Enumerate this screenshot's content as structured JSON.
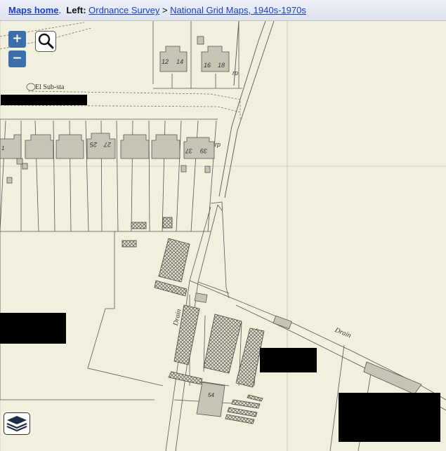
{
  "breadcrumb": {
    "home": "Maps home",
    "left_label": "Left:",
    "level1": "Ordnance Survey",
    "separator": ">",
    "level2": "National Grid Maps, 1940s-1970s"
  },
  "controls": {
    "zoom_in": "+",
    "zoom_out": "−"
  },
  "map_labels": {
    "substation": "El Sub-sta",
    "house_12": "12",
    "house_14": "14",
    "house_16": "16",
    "house_18": "18",
    "rp_upper": "rp",
    "rp_lower": "rp",
    "house_1": "1",
    "house_25": "25",
    "house_27": "27",
    "house_37": "37",
    "house_39": "39",
    "drain_west": "Drain",
    "drain_east": "Drain",
    "house_54": "54"
  },
  "colors": {
    "paper": "#f2efdc",
    "line": "#6f6f66",
    "building": "#c7c4b5",
    "link": "#1a3fcf",
    "button": "#3c6ea9"
  }
}
